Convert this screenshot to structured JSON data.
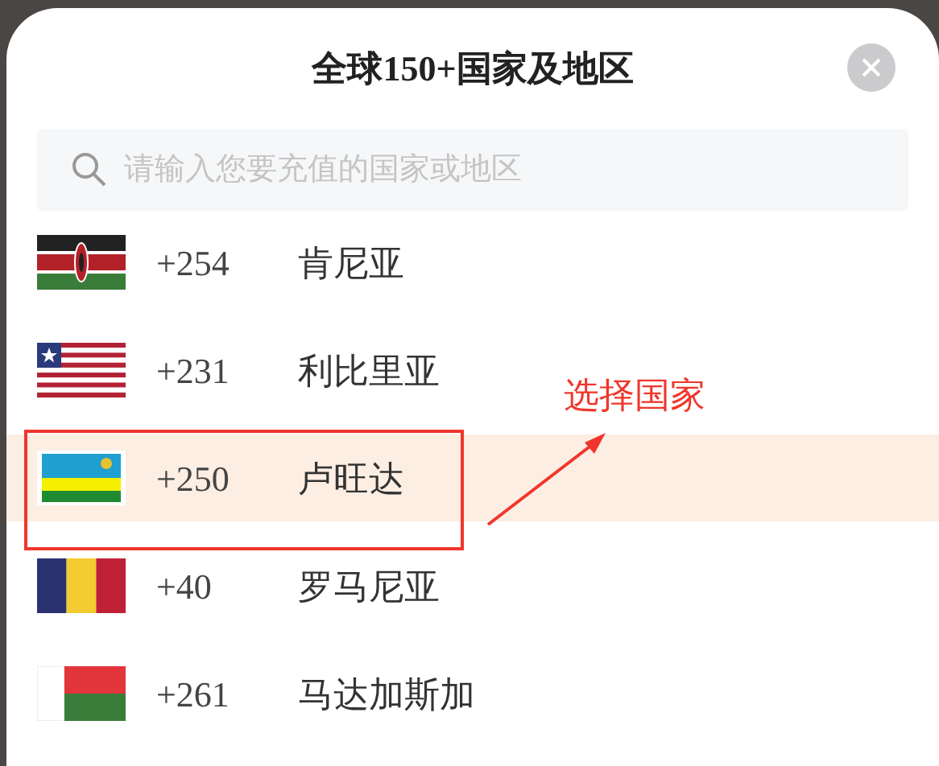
{
  "title": "全球150+国家及地区",
  "search": {
    "placeholder": "请输入您要充值的国家或地区"
  },
  "countries": [
    {
      "code": "+254",
      "name": "肯尼亚",
      "selected": false
    },
    {
      "code": "+231",
      "name": "利比里亚",
      "selected": false
    },
    {
      "code": "+250",
      "name": "卢旺达",
      "selected": true
    },
    {
      "code": "+40",
      "name": "罗马尼亚",
      "selected": false
    },
    {
      "code": "+261",
      "name": "马达加斯加",
      "selected": false
    }
  ],
  "annotation": {
    "label": "选择国家"
  }
}
